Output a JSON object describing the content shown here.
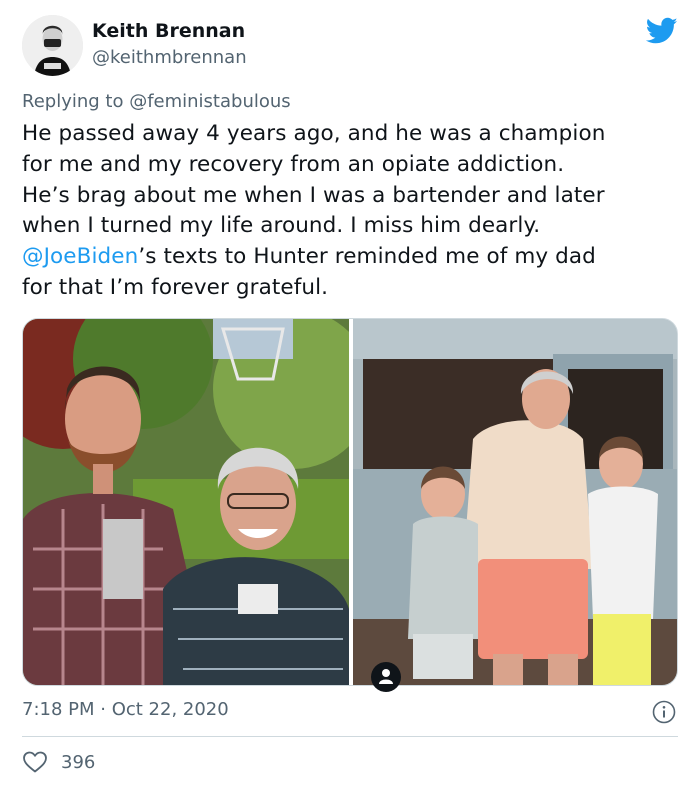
{
  "author": {
    "display_name": "Keith Brennan",
    "handle": "@keithmbrennan",
    "avatar_icon": "avatar-photo"
  },
  "platform_icon": "twitter-bird-icon",
  "reply": {
    "prefix": "Replying to ",
    "to": "@feministabulous"
  },
  "body": {
    "line1": "He passed away 4 years ago, and he was a champion",
    "line2": "for me and my recovery from an opiate addiction.",
    "line3": "He’s brag about me when I was a bartender and later",
    "line4": "when I turned my life around. I miss him dearly.",
    "line5_link": "@JoeBiden",
    "line5_rest": "’s texts to Hunter reminded me of my dad",
    "line6": "for that I’m forever grateful."
  },
  "media": {
    "photo_left_alt": "photo",
    "photo_right_alt": "photo",
    "badge_icon": "person-icon"
  },
  "timestamp": {
    "time": "7:18 PM",
    "separator": " · ",
    "date": "Oct 22, 2020"
  },
  "actions": {
    "like_icon": "heart-icon",
    "like_count": "396",
    "info_icon": "info-icon"
  },
  "colors": {
    "link": "#1d9bf0",
    "secondary_text": "#536471",
    "primary_text": "#0f1419",
    "border": "#cfd9de"
  }
}
